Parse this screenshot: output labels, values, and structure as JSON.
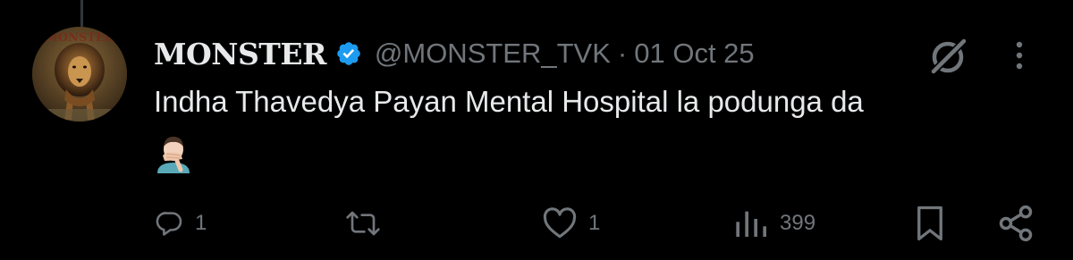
{
  "tweet": {
    "display_name": "MONSTER",
    "handle": "@MONSTER_TVK",
    "separator": "·",
    "date": "01 Oct 25",
    "text": "Indha Thavedya Payan Mental Hospital la podunga da",
    "emoji": "man-facepalming-emoji",
    "verified": true
  },
  "avatar": {
    "watermark": "MONSTER"
  },
  "actions": {
    "reply": {
      "icon": "reply-icon",
      "count": "1"
    },
    "retweet": {
      "icon": "retweet-icon",
      "count": ""
    },
    "like": {
      "icon": "heart-icon",
      "count": "1"
    },
    "views": {
      "icon": "views-icon",
      "count": "399"
    },
    "bookmark": {
      "icon": "bookmark-icon"
    },
    "share": {
      "icon": "share-icon"
    }
  },
  "colors": {
    "background": "#000000",
    "primary_text": "#e7e9ea",
    "secondary_text": "#71767b",
    "verified_blue": "#1d9bf0"
  }
}
